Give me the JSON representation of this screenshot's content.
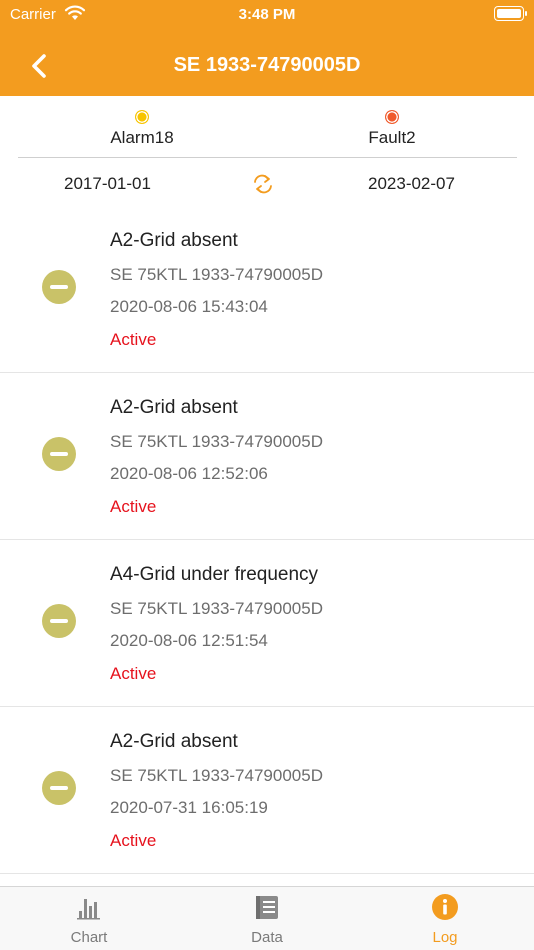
{
  "status_bar": {
    "carrier": "Carrier",
    "time": "3:48 PM"
  },
  "nav": {
    "title": "SE 1933-74790005D"
  },
  "summary": {
    "alarm_label": "Alarm18",
    "fault_label": "Fault2",
    "start_date": "2017-01-01",
    "end_date": "2023-02-07"
  },
  "logs": [
    {
      "title": "A2-Grid absent",
      "device": "SE 75KTL 1933-74790005D",
      "time": "2020-08-06 15:43:04",
      "status": "Active"
    },
    {
      "title": "A2-Grid absent",
      "device": "SE 75KTL 1933-74790005D",
      "time": "2020-08-06 12:52:06",
      "status": "Active"
    },
    {
      "title": "A4-Grid under frequency",
      "device": "SE 75KTL 1933-74790005D",
      "time": "2020-08-06 12:51:54",
      "status": "Active"
    },
    {
      "title": "A2-Grid absent",
      "device": "SE 75KTL 1933-74790005D",
      "time": "2020-07-31 16:05:19",
      "status": "Active"
    }
  ],
  "tabs": [
    {
      "label": "Chart",
      "icon": "bar-chart-icon"
    },
    {
      "label": "Data",
      "icon": "document-icon"
    },
    {
      "label": "Log",
      "icon": "info-icon"
    }
  ],
  "colors": {
    "accent": "#f39c1f",
    "alarm": "#f7c400",
    "fault": "#f05a2b",
    "status_active": "#e6121d",
    "status_icon": "#c9c268"
  }
}
